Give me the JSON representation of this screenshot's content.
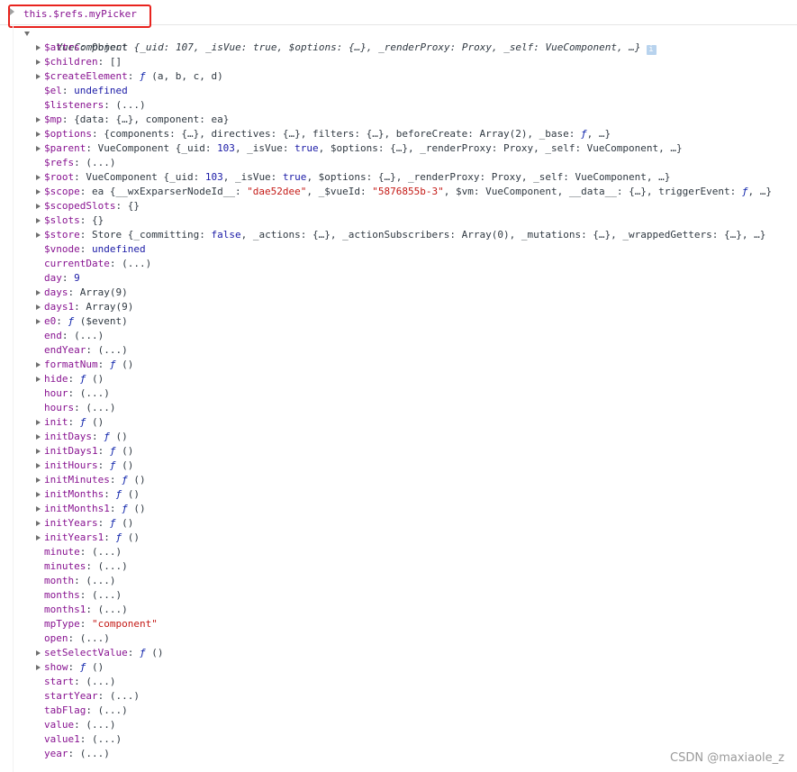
{
  "console": {
    "input": "this.$refs.myPicker",
    "root_summary": "VueComponent {_uid: 107, _isVue: true, $options: {…}, _renderProxy: Proxy, _self: VueComponent, …}",
    "info_badge": "i"
  },
  "props": [
    {
      "key": "$attrs",
      "value": "Object",
      "expandable": true
    },
    {
      "key": "$children",
      "value": "[]",
      "expandable": true
    },
    {
      "key": "$createElement",
      "value": "ƒ (a, b, c, d)",
      "expandable": true
    },
    {
      "key": "$el",
      "value": "undefined",
      "expandable": false
    },
    {
      "key": "$listeners",
      "value": "(...)",
      "expandable": false
    },
    {
      "key": "$mp",
      "value": "{data: {…}, component: ea}",
      "expandable": true
    },
    {
      "key": "$options",
      "value": "{components: {…}, directives: {…}, filters: {…}, beforeCreate: Array(2), _base: ƒ, …}",
      "expandable": true
    },
    {
      "key": "$parent",
      "value": "VueComponent {_uid: 103, _isVue: true, $options: {…}, _renderProxy: Proxy, _self: VueComponent, …}",
      "expandable": true
    },
    {
      "key": "$refs",
      "value": "(...)",
      "expandable": false
    },
    {
      "key": "$root",
      "value": "VueComponent {_uid: 103, _isVue: true, $options: {…}, _renderProxy: Proxy, _self: VueComponent, …}",
      "expandable": true
    },
    {
      "key": "$scope",
      "value": "ea {__wxExparserNodeId__: \"dae52dee\", _$vueId: \"5876855b-3\", $vm: VueComponent, __data__: {…}, triggerEvent: ƒ, …}",
      "expandable": true
    },
    {
      "key": "$scopedSlots",
      "value": "{}",
      "expandable": true
    },
    {
      "key": "$slots",
      "value": "{}",
      "expandable": true
    },
    {
      "key": "$store",
      "value": "Store {_committing: false, _actions: {…}, _actionSubscribers: Array(0), _mutations: {…}, _wrappedGetters: {…}, …}",
      "expandable": true
    },
    {
      "key": "$vnode",
      "value": "undefined",
      "expandable": false
    },
    {
      "key": "currentDate",
      "value": "(...)",
      "expandable": false
    },
    {
      "key": "day",
      "value": "9",
      "expandable": false
    },
    {
      "key": "days",
      "value": "Array(9)",
      "expandable": true
    },
    {
      "key": "days1",
      "value": "Array(9)",
      "expandable": true
    },
    {
      "key": "e0",
      "value": "ƒ ($event)",
      "expandable": true
    },
    {
      "key": "end",
      "value": "(...)",
      "expandable": false
    },
    {
      "key": "endYear",
      "value": "(...)",
      "expandable": false
    },
    {
      "key": "formatNum",
      "value": "ƒ ()",
      "expandable": true
    },
    {
      "key": "hide",
      "value": "ƒ ()",
      "expandable": true
    },
    {
      "key": "hour",
      "value": "(...)",
      "expandable": false
    },
    {
      "key": "hours",
      "value": "(...)",
      "expandable": false
    },
    {
      "key": "init",
      "value": "ƒ ()",
      "expandable": true
    },
    {
      "key": "initDays",
      "value": "ƒ ()",
      "expandable": true
    },
    {
      "key": "initDays1",
      "value": "ƒ ()",
      "expandable": true
    },
    {
      "key": "initHours",
      "value": "ƒ ()",
      "expandable": true
    },
    {
      "key": "initMinutes",
      "value": "ƒ ()",
      "expandable": true
    },
    {
      "key": "initMonths",
      "value": "ƒ ()",
      "expandable": true
    },
    {
      "key": "initMonths1",
      "value": "ƒ ()",
      "expandable": true
    },
    {
      "key": "initYears",
      "value": "ƒ ()",
      "expandable": true
    },
    {
      "key": "initYears1",
      "value": "ƒ ()",
      "expandable": true
    },
    {
      "key": "minute",
      "value": "(...)",
      "expandable": false
    },
    {
      "key": "minutes",
      "value": "(...)",
      "expandable": false
    },
    {
      "key": "month",
      "value": "(...)",
      "expandable": false
    },
    {
      "key": "months",
      "value": "(...)",
      "expandable": false
    },
    {
      "key": "months1",
      "value": "(...)",
      "expandable": false
    },
    {
      "key": "mpType",
      "value": "\"component\"",
      "expandable": false
    },
    {
      "key": "open",
      "value": "(...)",
      "expandable": false
    },
    {
      "key": "setSelectValue",
      "value": "ƒ ()",
      "expandable": true
    },
    {
      "key": "show",
      "value": "ƒ ()",
      "expandable": true
    },
    {
      "key": "start",
      "value": "(...)",
      "expandable": false
    },
    {
      "key": "startYear",
      "value": "(...)",
      "expandable": false
    },
    {
      "key": "tabFlag",
      "value": "(...)",
      "expandable": false
    },
    {
      "key": "value",
      "value": "(...)",
      "expandable": false
    },
    {
      "key": "value1",
      "value": "(...)",
      "expandable": false
    },
    {
      "key": "year",
      "value": "(...)",
      "expandable": false
    }
  ],
  "watermark": "CSDN @maxiaole_z",
  "colors": {
    "key": "#881391",
    "highlight": "#e8231e",
    "string": "#c41a16",
    "boolean": "#1a1aa6"
  }
}
